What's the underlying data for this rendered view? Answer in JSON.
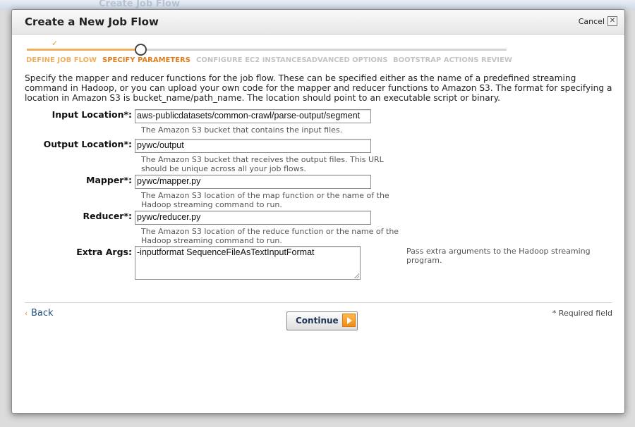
{
  "background": {
    "ghost_title": "Create Job Flow"
  },
  "dialog": {
    "title": "Create a New Job Flow",
    "cancel_label": "Cancel",
    "close_glyph": "✕"
  },
  "wizard": {
    "check_glyph": "✓",
    "steps": [
      {
        "label": "DEFINE JOB FLOW",
        "state": "done"
      },
      {
        "label": "SPECIFY PARAMETERS",
        "state": "current"
      },
      {
        "label": "CONFIGURE EC2 INSTANCES",
        "state": "todo"
      },
      {
        "label": "ADVANCED OPTIONS",
        "state": "todo"
      },
      {
        "label": "BOOTSTRAP ACTIONS",
        "state": "todo"
      },
      {
        "label": "REVIEW",
        "state": "todo"
      }
    ]
  },
  "intro": "Specify the mapper and reducer functions for the job flow. These can be specified either as the name of a predefined streaming command in Hadoop, or you can upload your own code for the mapper and reducer functions to Amazon S3. The format for specifying a location in Amazon S3 is bucket_name/path_name. The location should point to an executable script or binary.",
  "form": {
    "input_location": {
      "label": "Input Location*:",
      "value": "aws-publicdatasets/common-crawl/parse-output/segment",
      "hint": "The Amazon S3 bucket that contains the input files."
    },
    "output_location": {
      "label": "Output Location*:",
      "value": "pywc/output",
      "hint": "The Amazon S3 bucket that receives the output files. This URL should be unique across all your job flows."
    },
    "mapper": {
      "label": "Mapper*:",
      "value": "pywc/mapper.py",
      "hint": "The Amazon S3 location of the map function or the name of the Hadoop streaming command to run."
    },
    "reducer": {
      "label": "Reducer*:",
      "value": "pywc/reducer.py",
      "hint": "The Amazon S3 location of the reduce function or the name of the Hadoop streaming command to run."
    },
    "extra_args": {
      "label": "Extra Args:",
      "value": "-inputformat SequenceFileAsTextInputFormat",
      "hint": "Pass extra arguments to the Hadoop streaming program."
    }
  },
  "footer": {
    "back_chevron": "‹",
    "back_label": "Back",
    "continue_label": "Continue",
    "required_note": "* Required field"
  },
  "colors": {
    "accent_orange": "#e27e1c",
    "link_blue": "#23527c"
  }
}
